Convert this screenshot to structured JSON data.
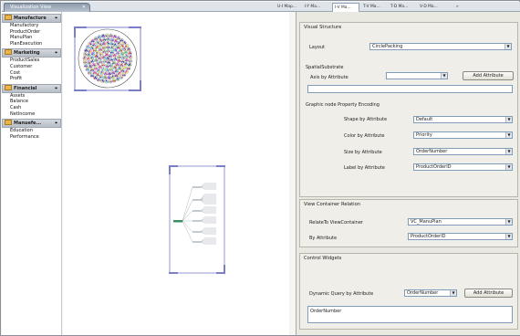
{
  "left_tab": {
    "label": "Visualization View",
    "close": "✕"
  },
  "nav": {
    "categories": [
      {
        "label": "Manufacture",
        "pin": "⌖",
        "items": [
          "Manufactory",
          "ProductOrder",
          "ManuPlan",
          "PlanExecution"
        ]
      },
      {
        "label": "Marketing",
        "pin": "⌖",
        "items": [
          "ProductSales",
          "Customer",
          "Cost",
          "Profit"
        ]
      },
      {
        "label": "Financial",
        "pin": "⌖",
        "items": [
          "Assets",
          "Balance",
          "Cash",
          "NetIncome"
        ]
      },
      {
        "label": "Manuefe...",
        "pin": "⌖",
        "items": [
          "Education",
          "Performance"
        ]
      }
    ]
  },
  "right_tabs": [
    "U-I Map...",
    "I-Y Ma...",
    "I-V Ma...",
    "T-V Ma...",
    "T-D Ma...",
    "V-D Ma..."
  ],
  "right_tabbar_overflow": "»",
  "visual_structure": {
    "title": "Visual Structure",
    "layout_label": "Layout",
    "layout_value": "CirclePacking",
    "spatial_title": "SpatialSubstrate",
    "axis_label": "Axis by Attribute",
    "axis_value": "",
    "add_attribute_button": "Add Attribute",
    "axis_list_value": ""
  },
  "graphic_encoding": {
    "title": "Graphic node Property Encoding",
    "shape_label": "Shape by Attribute",
    "shape_value": "Default",
    "color_label": "Color by Attribute",
    "color_value": "Priority",
    "size_label": "Size by Attribute",
    "size_value": "OrderNumber",
    "node_label_label": "Label by Attribute",
    "node_label_value": "ProductOrderID"
  },
  "view_container": {
    "title": "View Container Relation",
    "relate_label": "RelateTo ViewContainer",
    "relate_value": "VC_ManuPlan",
    "by_label": "By Attribute",
    "by_value": "ProductOrderID"
  },
  "control_widgets": {
    "title": "Control Widgets",
    "dq_label": "Dynamic Query by Attribute",
    "dq_value": "OrderNumber",
    "add_attribute_button": "Add Attribute",
    "dq_list_value": "OrderNumber"
  },
  "dropdown_arrow": "▼",
  "colors": {
    "accent": "#6a5acd",
    "frame": "#7b7fc8",
    "tab_active": "#9aa7b6"
  }
}
